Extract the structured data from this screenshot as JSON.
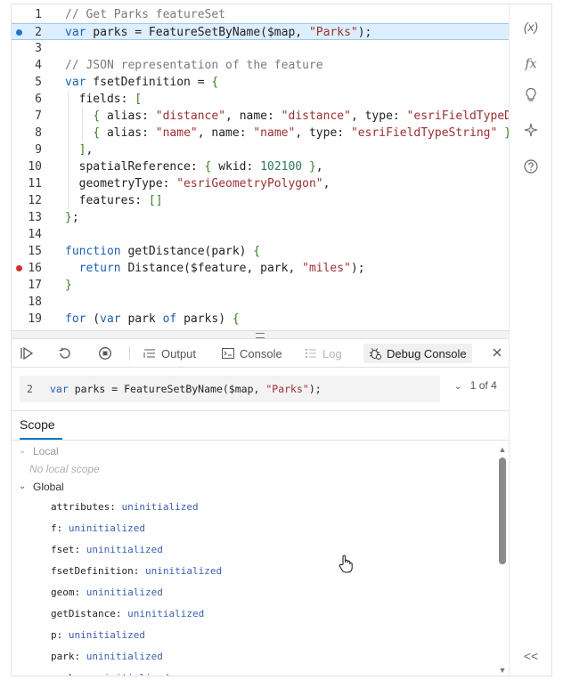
{
  "editor": {
    "lines": [
      {
        "num": "1",
        "text": "// Get Parks featureSet",
        "type": "comment"
      },
      {
        "num": "2",
        "text": "var parks = FeatureSetByName($map, \"Parks\");",
        "active": true,
        "breakpoint": "blue"
      },
      {
        "num": "3",
        "text": ""
      },
      {
        "num": "4",
        "text": "// JSON representation of the feature",
        "type": "comment"
      },
      {
        "num": "5",
        "text": "var fsetDefinition = {"
      },
      {
        "num": "6",
        "text": "  fields: ["
      },
      {
        "num": "7",
        "text": "    { alias: \"distance\", name: \"distance\", type: \"esriFieldTypeDo"
      },
      {
        "num": "8",
        "text": "    { alias: \"name\", name: \"name\", type: \"esriFieldTypeString\" }"
      },
      {
        "num": "9",
        "text": "  ],"
      },
      {
        "num": "10",
        "text": "  spatialReference: { wkid: 102100 },"
      },
      {
        "num": "11",
        "text": "  geometryType: \"esriGeometryPolygon\","
      },
      {
        "num": "12",
        "text": "  features: []"
      },
      {
        "num": "13",
        "text": "};"
      },
      {
        "num": "14",
        "text": ""
      },
      {
        "num": "15",
        "text": "function getDistance(park) {"
      },
      {
        "num": "16",
        "text": "  return Distance($feature, park, \"miles\");",
        "breakpoint": "red"
      },
      {
        "num": "17",
        "text": "}"
      },
      {
        "num": "18",
        "text": ""
      },
      {
        "num": "19",
        "text": "for (var park of parks) {"
      }
    ]
  },
  "rail": {
    "icons": [
      "variables-icon",
      "functions-icon",
      "suggestions-icon",
      "ai-assistant-icon",
      "help-icon",
      "collapse-icon"
    ],
    "variables_label": "(x)",
    "functions_label": "fx",
    "collapse_label": "<<"
  },
  "toolbar": {
    "tabs": {
      "output": "Output",
      "console": "Console",
      "log": "Log",
      "debug_console": "Debug Console"
    }
  },
  "debug": {
    "line_number": "2",
    "line_text": "var parks = FeatureSetByName($map, \"Parks\");",
    "pager": "1 of 4"
  },
  "scope": {
    "tab_label": "Scope",
    "local_label": "Local",
    "no_local": "No local scope",
    "global_label": "Global",
    "variables": [
      {
        "name": "attributes",
        "value": "uninitialized"
      },
      {
        "name": "f",
        "value": "uninitialized"
      },
      {
        "name": "fset",
        "value": "uninitialized"
      },
      {
        "name": "fsetDefinition",
        "value": "uninitialized"
      },
      {
        "name": "geom",
        "value": "uninitialized"
      },
      {
        "name": "getDistance",
        "value": "uninitialized"
      },
      {
        "name": "p",
        "value": "uninitialized"
      },
      {
        "name": "park",
        "value": "uninitialized"
      },
      {
        "name": "parks",
        "value": "uninitialized"
      }
    ]
  },
  "colors": {
    "keyword": "#1c5fb3",
    "string": "#9c2f2f",
    "comment": "#7a7a7a",
    "number": "#2b7a5a",
    "active_line": "#ddeeff",
    "accent": "#007ac2"
  }
}
